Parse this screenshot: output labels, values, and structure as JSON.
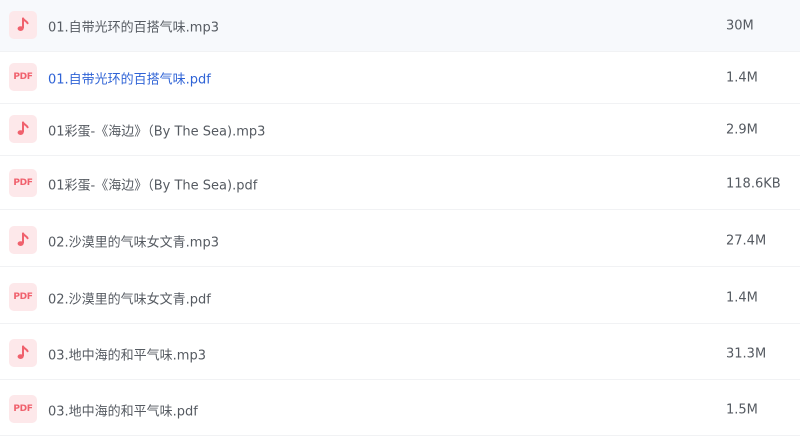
{
  "file_list": {
    "items": [
      {
        "type": "audio",
        "name": "01.自带光环的百搭气味.mp3",
        "size": "30M",
        "active": false
      },
      {
        "type": "pdf",
        "icon_label": "PDF",
        "name": "01.自带光环的百搭气味.pdf",
        "size": "1.4M",
        "active": true
      },
      {
        "type": "audio",
        "name": "01彩蛋-《海边》（By The Sea).mp3",
        "size": "2.9M",
        "active": false
      },
      {
        "type": "pdf",
        "icon_label": "PDF",
        "name": "01彩蛋-《海边》（By The Sea).pdf",
        "size": "118.6KB",
        "active": false
      },
      {
        "type": "audio",
        "name": "02.沙漠里的气味女文青.mp3",
        "size": "27.4M",
        "active": false
      },
      {
        "type": "pdf",
        "icon_label": "PDF",
        "name": "02.沙漠里的气味女文青.pdf",
        "size": "1.4M",
        "active": false
      },
      {
        "type": "audio",
        "name": "03.地中海的和平气味.mp3",
        "size": "31.3M",
        "active": false
      },
      {
        "type": "pdf",
        "icon_label": "PDF",
        "name": "03.地中海的和平气味.pdf",
        "size": "1.5M",
        "active": false
      }
    ]
  },
  "icons": {
    "audio": "music-note-icon",
    "pdf": "pdf-icon"
  },
  "colors": {
    "icon_bg": "#fde8ea",
    "icon_fg": "#f0616d",
    "text": "#555a61",
    "active_text": "#2f63d6"
  }
}
